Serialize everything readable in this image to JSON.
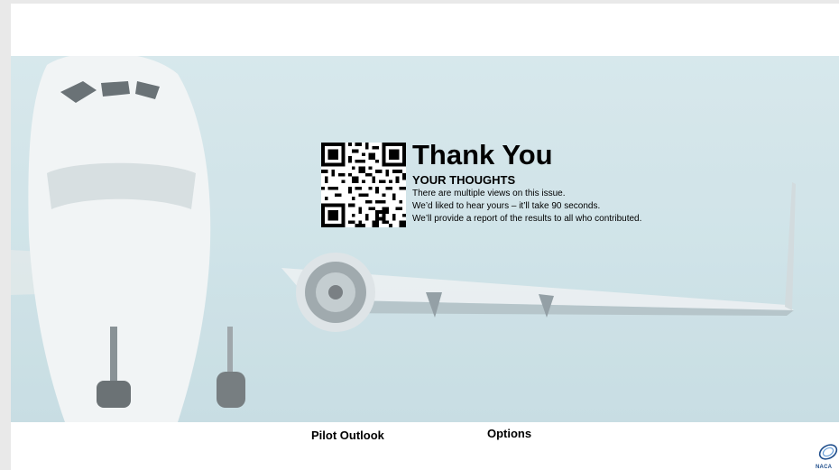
{
  "slide": {
    "title": "Thank You",
    "subtitle": "YOUR THOUGHTS",
    "lines": [
      "There are multiple views on this issue.",
      "We’d liked to hear yours – it’ll take 90 seconds.",
      "We’ll provide a report of the results to all who contributed."
    ],
    "qr_icon": "qr-code-icon",
    "background_image": "airliner-landing-photo"
  },
  "footer": {
    "left_label": "Pilot Outlook",
    "right_label": "Options",
    "logo_text": "NACA"
  },
  "colors": {
    "sky": "#c5dde3",
    "page": "#e9e9e9"
  }
}
